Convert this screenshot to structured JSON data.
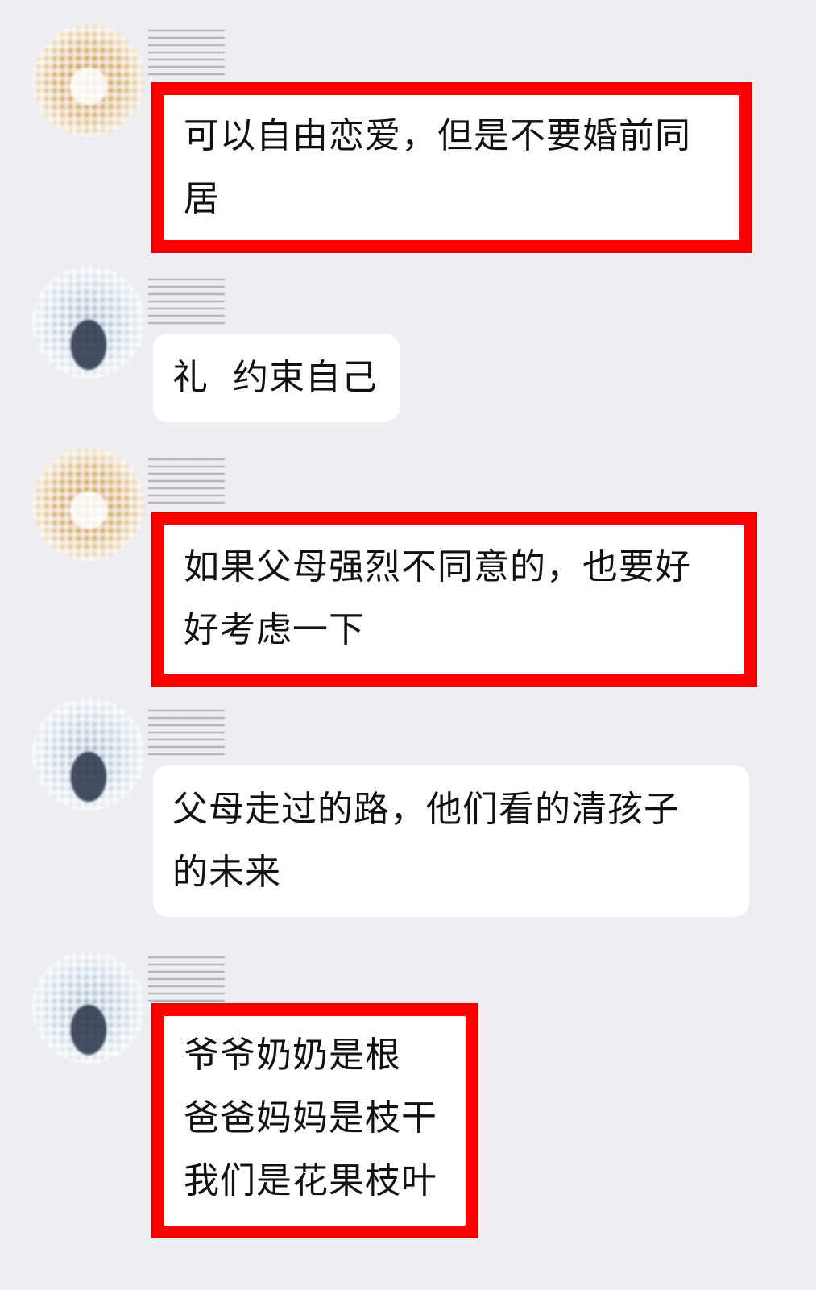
{
  "chat": {
    "messages": [
      {
        "sender": "contact-a",
        "highlighted": true,
        "lines": [
          "可以自由恋爱，但是不要婚前同",
          "居"
        ]
      },
      {
        "sender": "contact-b",
        "highlighted": false,
        "lines": [
          "礼  约束自己"
        ]
      },
      {
        "sender": "contact-a",
        "highlighted": true,
        "lines": [
          "如果父母强烈不同意的，也要好",
          "好考虑一下"
        ]
      },
      {
        "sender": "contact-b",
        "highlighted": false,
        "lines": [
          "父母走过的路，他们看的清孩子",
          "的未来"
        ]
      },
      {
        "sender": "contact-b",
        "highlighted": true,
        "lines": [
          "爷爷奶奶是根",
          "爸爸妈妈是枝干",
          "我们是花果枝叶"
        ]
      }
    ]
  },
  "style": {
    "background": "#ededf2",
    "bubble_color": "#ffffff",
    "highlight_border_color": "#ff0000",
    "text_color": "#111111"
  }
}
